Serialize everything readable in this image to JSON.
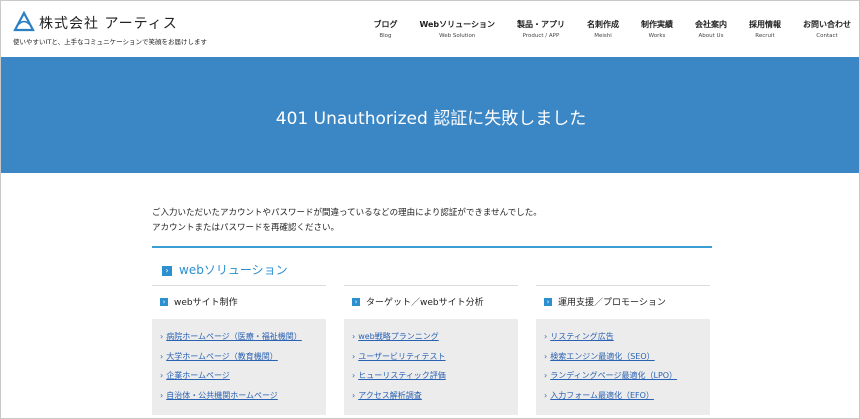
{
  "header": {
    "logo_name": "株式会社 アーティス",
    "logo_tagline": "使いやすいITと、上手なコミュニケーションで笑顔をお届けします",
    "nav": [
      {
        "ja": "ブログ",
        "en": "Blog"
      },
      {
        "ja": "Webソリューション",
        "en": "Web Solution"
      },
      {
        "ja": "製品・アプリ",
        "en": "Product / APP"
      },
      {
        "ja": "名刺作成",
        "en": "Meishi"
      },
      {
        "ja": "制作実績",
        "en": "Works"
      },
      {
        "ja": "会社案内",
        "en": "About Us"
      },
      {
        "ja": "採用情報",
        "en": "Recruit"
      },
      {
        "ja": "お問い合わせ",
        "en": "Contact"
      }
    ]
  },
  "hero": {
    "title": "401 Unauthorized 認証に失敗しました"
  },
  "message": {
    "line1": "ご入力いただいたアカウントやパスワードが間違っているなどの理由により認証ができませんでした。",
    "line2": "アカウントまたはパスワードを再確認ください。"
  },
  "section": {
    "title": "webソリューション",
    "chevron": "›"
  },
  "columns": [
    {
      "heading": "webサイト制作",
      "links": [
        "病院ホームページ（医療・福祉機関）",
        "大学ホームページ（教育機関）",
        "企業ホームページ",
        "自治体・公共機関ホームページ"
      ]
    },
    {
      "heading": "ターゲット／webサイト分析",
      "links": [
        "web戦略プランニング",
        "ユーザービリティテスト",
        "ヒューリスティック評価",
        "アクセス解析調査"
      ]
    },
    {
      "heading": "運用支援／プロモーション",
      "links": [
        "リスティング広告",
        "検索エンジン最適化（SEO）",
        "ランディングページ最適化（LPO）",
        "入力フォーム最適化（EFO）"
      ]
    }
  ],
  "link_arrow": "›",
  "colors": {
    "hero_bg": "#3b86c4",
    "accent": "#2b8fd0",
    "link": "#2a62b3",
    "box_bg": "#ececec"
  }
}
